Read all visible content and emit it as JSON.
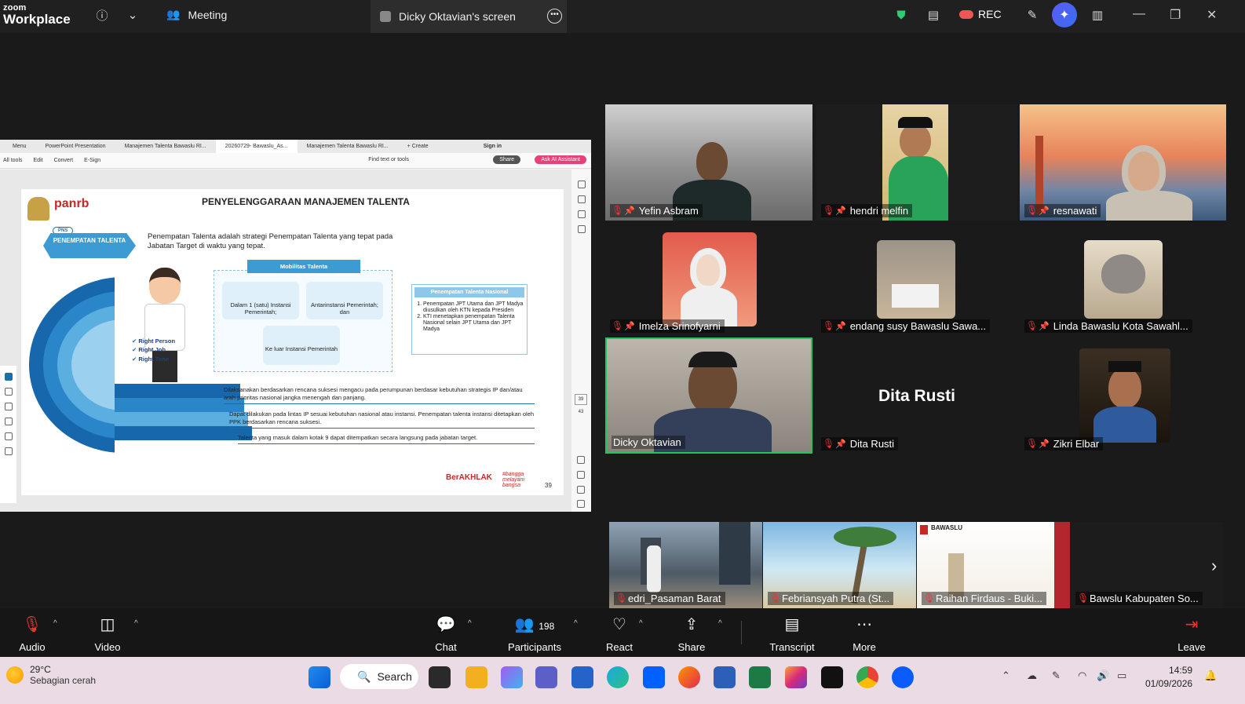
{
  "app": {
    "logo_line1": "zoom",
    "logo_line2": "Workplace"
  },
  "header": {
    "meeting_tab": "Meeting",
    "screen_tab": "Dicky Oktavian's screen",
    "rec_label": "REC"
  },
  "browser": {
    "menu": "Menu",
    "tabs": [
      "PowerPoint Presentation",
      "Manajemen Talenta Bawaslu RI...",
      "20260729- Bawaslu_As...",
      "Manajemen Talenta Bawaslu RI...",
      "+ Create"
    ],
    "sign_in": "Sign in",
    "tools": [
      "All tools",
      "Edit",
      "Convert",
      "E-Sign"
    ],
    "find": "Find text or tools",
    "share": "Share",
    "ask_ai": "Ask AI Assistant",
    "page_box": "39",
    "page_total": "43"
  },
  "slide": {
    "title": "PENYELENGGARAAN MANAJEMEN TALENTA",
    "logo": "panrb",
    "pns": "PNS",
    "badge": "PENEMPATAN TALENTA",
    "intro": "Penempatan Talenta adalah strategi Penempatan Talenta yang tepat pada Jabatan Target di waktu yang tepat.",
    "mobilitas": "Mobilitas Talenta",
    "mob_items": [
      "Dalam 1 (satu) Instansi Pemerintah;",
      "Antarinstansi Pemerintah; dan",
      "Ke luar Instansi Pemerintah"
    ],
    "right_labels": [
      "Right Person",
      "Right Job",
      "Right Time"
    ],
    "tn_head": "Penempatan Talenta Nasional",
    "tn_items": [
      "Penempatan JPT Utama dan JPT Madya diusulkan oleh KTN kepada Presiden",
      "KTI menetapkan penempatan Talenta Nasional selain JPT Utama dan JPT Madya"
    ],
    "steps": [
      "Dilaksanakan berdasarkan rencana suksesi mengacu pada perumpunan berdasar kebutuhan strategis IP dan/atau arah prioritas nasional jangka menengah dan panjang.",
      "Dapat dilakukan pada lintas IP sesuai kebutuhan nasional atau instansi. Penempatan talenta instansi ditetapkan oleh PPK berdasarkan rencana suksesi.",
      "Talenta yang masuk dalam kotak 9 dapat ditempatkan secara langsung pada jabatan target."
    ],
    "berakhlak": "BerAKHLAK",
    "bangga": "#bangga melayani bangsa",
    "page": "39"
  },
  "participants_grid": [
    {
      "name": "Yefin Asbram"
    },
    {
      "name": "hendri melfin"
    },
    {
      "name": "resnawati"
    },
    {
      "name": "Imelza Srinofyarni"
    },
    {
      "name": "endang susy Bawaslu Sawa..."
    },
    {
      "name": "Linda Bawaslu Kota Sawahl..."
    },
    {
      "name": "Dicky Oktavian"
    },
    {
      "name": "Dita Rusti",
      "display": "Dita Rusti"
    },
    {
      "name": "Zikri Elbar"
    }
  ],
  "strip": [
    {
      "name": "edri_Pasaman Barat"
    },
    {
      "name": "Febriansyah Putra (St..."
    },
    {
      "name": "Raihan Firdaus - Buki..."
    },
    {
      "name": "Bawslu Kabupaten So..."
    }
  ],
  "strip_logo": "BAWASLU",
  "toolbar": {
    "audio": "Audio",
    "video": "Video",
    "chat": "Chat",
    "participants": "Participants",
    "participants_count": "198",
    "react": "React",
    "share": "Share",
    "transcript": "Transcript",
    "more": "More",
    "leave": "Leave"
  },
  "taskbar": {
    "temp": "29°C",
    "weather": "Sebagian cerah",
    "search": "Search",
    "time": "14:59",
    "date": "01/09/2026"
  },
  "colors": {
    "accent": "#0b5cff",
    "active_speaker": "#22c55e",
    "muted": "#e33333",
    "slide_blue": "#3d9bd3"
  }
}
